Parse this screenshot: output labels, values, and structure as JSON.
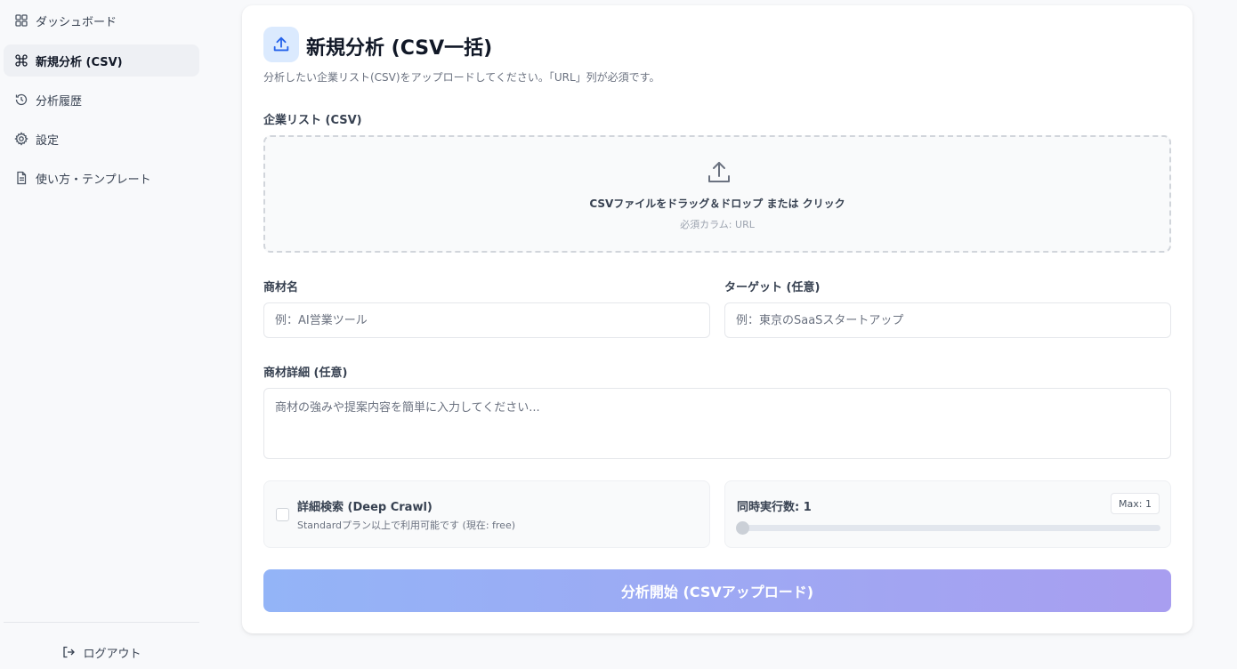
{
  "sidebar": {
    "items": [
      {
        "label": "ダッシュボード",
        "icon": "dashboard-icon"
      },
      {
        "label": "新規分析 (CSV)",
        "icon": "command-icon",
        "active": true
      },
      {
        "label": "分析履歴",
        "icon": "history-icon"
      },
      {
        "label": "設定",
        "icon": "gear-icon"
      },
      {
        "label": "使い方・テンプレート",
        "icon": "document-icon"
      }
    ],
    "logout": "ログアウト"
  },
  "page": {
    "title": "新規分析 (CSV一括)",
    "description": "分析したい企業リスト(CSV)をアップロードしてください。「URL」列が必須です。"
  },
  "upload": {
    "label": "企業リスト (CSV)",
    "instruction": "CSVファイルをドラッグ＆ドロップ または クリック",
    "required_columns": "必須カラム: URL"
  },
  "form": {
    "product_name": {
      "label": "商材名",
      "placeholder": "例：AI営業ツール",
      "value": ""
    },
    "target": {
      "label": "ターゲット (任意)",
      "placeholder": "例：東京のSaaSスタートアップ",
      "value": ""
    },
    "product_detail": {
      "label": "商材詳細 (任意)",
      "placeholder": "商材の強みや提案内容を簡単に入力してください...",
      "value": ""
    }
  },
  "deep_crawl": {
    "label": "詳細検索 (Deep Crawl)",
    "note": "Standardプラン以上で利用可能です (現在: free)",
    "checked": false
  },
  "concurrency": {
    "label": "同時実行数: 1",
    "max": "Max: 1",
    "value": 1
  },
  "submit_label": "分析開始 (CSVアップロード)",
  "colors": {
    "accent": "#2563eb",
    "accent_light": "#dbeafe",
    "button_gradient_start": "#93b4f7",
    "button_gradient_end": "#a89ef0"
  }
}
